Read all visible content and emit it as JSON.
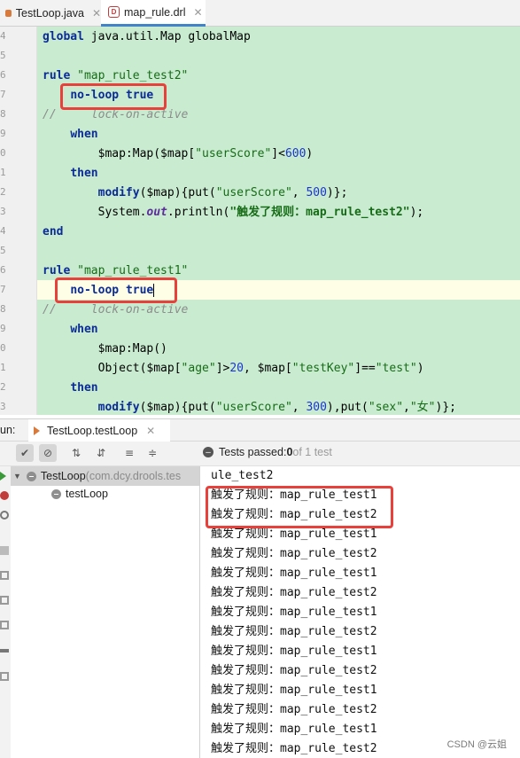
{
  "tabs": [
    {
      "label": "TestLoop.java",
      "active": false
    },
    {
      "label": "map_rule.drl",
      "active": true
    }
  ],
  "gutter_numbers": [
    "4",
    "5",
    "6",
    "7",
    "8",
    "9",
    "0",
    "1",
    "2",
    "3",
    "4",
    "5",
    "6",
    "7",
    "8",
    "9",
    "0",
    "1",
    "2",
    "3",
    "4"
  ],
  "code_lines": [
    [
      {
        "t": "global",
        "c": "kw"
      },
      {
        "t": " java.util.Map globalMap",
        "c": ""
      }
    ],
    [],
    [
      {
        "t": "rule",
        "c": "kw"
      },
      {
        "t": " \"map_rule_test2\"",
        "c": "str"
      }
    ],
    [
      {
        "t": "    ",
        "c": ""
      },
      {
        "t": "no-loop",
        "c": "kw"
      },
      {
        "t": " ",
        "c": ""
      },
      {
        "t": "true",
        "c": "kw"
      }
    ],
    [
      {
        "t": "//     lock-on-active",
        "c": "cm"
      }
    ],
    [
      {
        "t": "    ",
        "c": ""
      },
      {
        "t": "when",
        "c": "kw"
      }
    ],
    [
      {
        "t": "        $map:Map($map[",
        "c": ""
      },
      {
        "t": "\"userScore\"",
        "c": "str"
      },
      {
        "t": "]<",
        "c": ""
      },
      {
        "t": "600",
        "c": "num"
      },
      {
        "t": ")",
        "c": ""
      }
    ],
    [
      {
        "t": "    ",
        "c": ""
      },
      {
        "t": "then",
        "c": "kw"
      }
    ],
    [
      {
        "t": "        ",
        "c": ""
      },
      {
        "t": "modify",
        "c": "kw"
      },
      {
        "t": "($map){put(",
        "c": ""
      },
      {
        "t": "\"userScore\"",
        "c": "str"
      },
      {
        "t": ", ",
        "c": ""
      },
      {
        "t": "500",
        "c": "num"
      },
      {
        "t": ")};",
        "c": ""
      }
    ],
    [
      {
        "t": "        System.",
        "c": ""
      },
      {
        "t": "out",
        "c": "it"
      },
      {
        "t": ".println(",
        "c": ""
      },
      {
        "t": "\"触发了规则：map_rule_test2\"",
        "c": "strb"
      },
      {
        "t": ");",
        "c": ""
      }
    ],
    [
      {
        "t": "end",
        "c": "kw"
      }
    ],
    [],
    [
      {
        "t": "rule",
        "c": "kw"
      },
      {
        "t": " \"map_rule_test1\"",
        "c": "str"
      }
    ],
    [
      {
        "t": "    ",
        "c": ""
      },
      {
        "t": "no-loop",
        "c": "kw"
      },
      {
        "t": " ",
        "c": ""
      },
      {
        "t": "true",
        "c": "kw"
      }
    ],
    [
      {
        "t": "//     lock-on-active",
        "c": "cm"
      }
    ],
    [
      {
        "t": "    ",
        "c": ""
      },
      {
        "t": "when",
        "c": "kw"
      }
    ],
    [
      {
        "t": "        $map:Map()",
        "c": ""
      }
    ],
    [
      {
        "t": "        Object($map[",
        "c": ""
      },
      {
        "t": "\"age\"",
        "c": "str"
      },
      {
        "t": "]>",
        "c": ""
      },
      {
        "t": "20",
        "c": "num"
      },
      {
        "t": ", $map[",
        "c": ""
      },
      {
        "t": "\"testKey\"",
        "c": "str"
      },
      {
        "t": "]==",
        "c": ""
      },
      {
        "t": "\"test\"",
        "c": "str"
      },
      {
        "t": ")",
        "c": ""
      }
    ],
    [
      {
        "t": "    ",
        "c": ""
      },
      {
        "t": "then",
        "c": "kw"
      }
    ],
    [
      {
        "t": "        ",
        "c": ""
      },
      {
        "t": "modify",
        "c": "kw"
      },
      {
        "t": "($map){put(",
        "c": ""
      },
      {
        "t": "\"userScore\"",
        "c": "str"
      },
      {
        "t": ", ",
        "c": ""
      },
      {
        "t": "300",
        "c": "num"
      },
      {
        "t": "),put(",
        "c": ""
      },
      {
        "t": "\"sex\"",
        "c": "str"
      },
      {
        "t": ",",
        "c": ""
      },
      {
        "t": "\"女\"",
        "c": "str"
      },
      {
        "t": ")};",
        "c": ""
      }
    ]
  ],
  "run": {
    "label": "un:",
    "tab_label": "TestLoop.testLoop",
    "status_prefix": "Tests passed: ",
    "passed": "0",
    "status_suffix": " of 1 test"
  },
  "tree": {
    "root_name": "TestLoop",
    "root_package": " (com.dcy.drools.tes",
    "child_name": "testLoop"
  },
  "console_lines": [
    "ule_test2",
    "触发了规则：map_rule_test1",
    "触发了规则：map_rule_test2",
    "触发了规则：map_rule_test1",
    "触发了规则：map_rule_test2",
    "触发了规则：map_rule_test1",
    "触发了规则：map_rule_test2",
    "触发了规则：map_rule_test1",
    "触发了规则：map_rule_test2",
    "触发了规则：map_rule_test1",
    "触发了规则：map_rule_test2",
    "触发了规则：map_rule_test1",
    "触发了规则：map_rule_test2",
    "触发了规则：map_rule_test1",
    "触发了规则：map_rule_test2"
  ],
  "watermark": "CSDN @云姐",
  "colors": {
    "highlight_box": "#e8413c",
    "editor_bg": "#c9ecd0",
    "keyword": "#0b2b96",
    "string": "#166b16"
  }
}
